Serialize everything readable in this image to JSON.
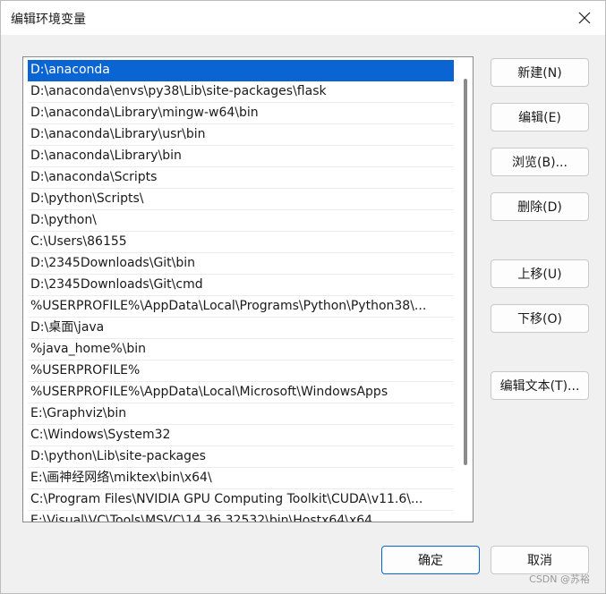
{
  "window": {
    "title": "编辑环境变量"
  },
  "paths": [
    "D:\\anaconda",
    "D:\\anaconda\\envs\\py38\\Lib\\site-packages\\flask",
    "D:\\anaconda\\Library\\mingw-w64\\bin",
    "D:\\anaconda\\Library\\usr\\bin",
    "D:\\anaconda\\Library\\bin",
    "D:\\anaconda\\Scripts",
    "D:\\python\\Scripts\\",
    "D:\\python\\",
    "C:\\Users\\86155",
    "D:\\2345Downloads\\Git\\bin",
    "D:\\2345Downloads\\Git\\cmd",
    "%USERPROFILE%\\AppData\\Local\\Programs\\Python\\Python38\\...",
    "D:\\桌面\\java",
    "%java_home%\\bin",
    "%USERPROFILE%",
    "%USERPROFILE%\\AppData\\Local\\Microsoft\\WindowsApps",
    "E:\\Graphviz\\bin",
    "C:\\Windows\\System32",
    "D:\\python\\Lib\\site-packages",
    "E:\\画神经网络\\miktex\\bin\\x64\\",
    "C:\\Program Files\\NVIDIA GPU Computing Toolkit\\CUDA\\v11.6\\...",
    "E:\\Visual\\VC\\Tools\\MSVC\\14.36.32532\\bin\\Hostx64\\x64"
  ],
  "buttons": {
    "new": "新建(N)",
    "edit": "编辑(E)",
    "browse": "浏览(B)...",
    "delete": "删除(D)",
    "move_up": "上移(U)",
    "move_down": "下移(O)",
    "edit_text": "编辑文本(T)...",
    "ok": "确定",
    "cancel": "取消"
  },
  "watermark": "CSDN @苏裕"
}
